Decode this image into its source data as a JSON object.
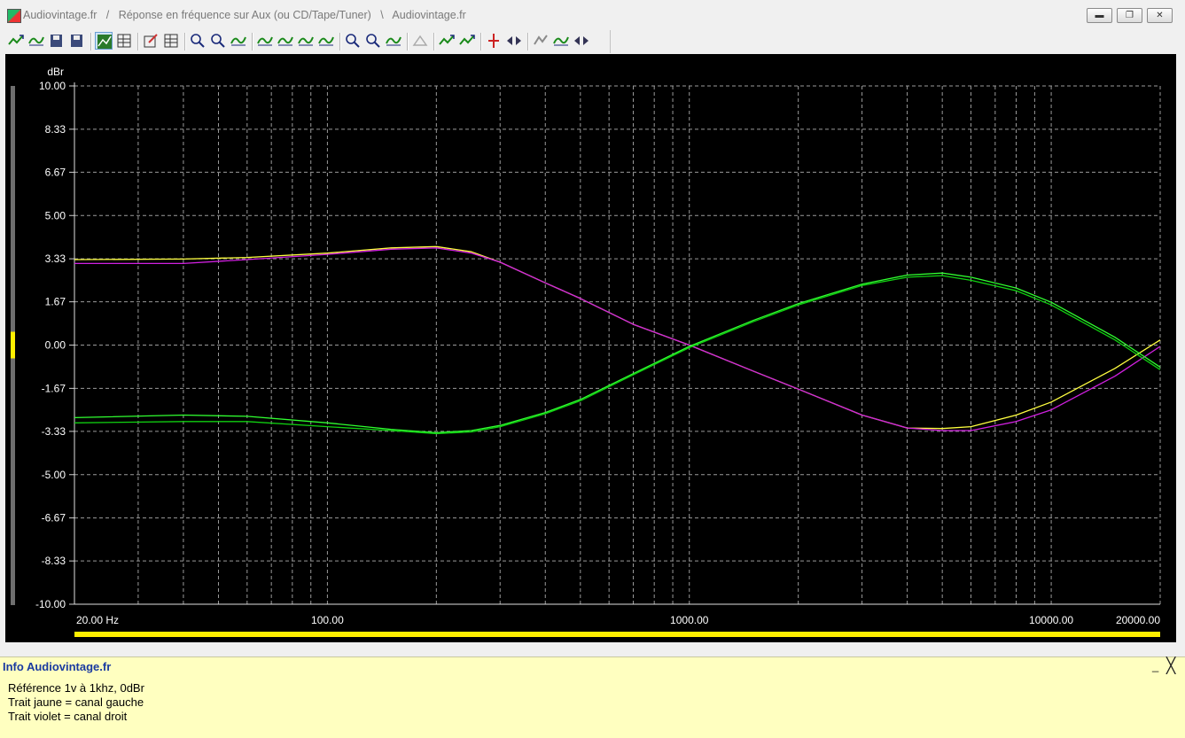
{
  "window": {
    "title": "Audiovintage.fr   /   Réponse en fréquence sur Aux (ou CD/Tape/Tuner)   \\   Audiovintage.fr",
    "minimize_label": "▬",
    "restore_label": "❐",
    "close_label": "✕"
  },
  "toolbar": {
    "groups": [
      [
        "add-curve-icon",
        "wave-icon",
        "save-icon",
        "copy-icon"
      ],
      [
        "graph-view-icon",
        "table-view-icon"
      ],
      [
        "edit-icon",
        "grid-points-icon"
      ],
      [
        "zoom-x-icon",
        "zoom-y-icon",
        "fit-curve-icon"
      ],
      [
        "curve-up-icon",
        "curve-down-icon",
        "curve-shift-icon",
        "curve-step-icon"
      ],
      [
        "zoom-in-icon",
        "zoom-out-icon",
        "reset-curve-icon"
      ],
      [
        "disabled-icon"
      ],
      [
        "marker-up-icon",
        "marker-down-icon"
      ],
      [
        "measure-icon",
        "arrows-icon"
      ],
      [
        "limit-icon",
        "compare-icon",
        "settings-icon"
      ]
    ]
  },
  "chart_data": {
    "type": "line",
    "ylabel": "dBr",
    "xscale": "log",
    "xlim": [
      20,
      20000
    ],
    "ylim": [
      -10,
      10
    ],
    "grid": true,
    "y_ticks": [
      "10.00",
      "8.33",
      "6.67",
      "5.00",
      "3.33",
      "1.67",
      "0.00",
      "-1.67",
      "-3.33",
      "-5.00",
      "-6.67",
      "-8.33",
      "-10.00"
    ],
    "x_ticks": [
      {
        "value": 20,
        "label": "20.00 Hz"
      },
      {
        "value": 100,
        "label": "100.00"
      },
      {
        "value": 1000,
        "label": "1000.00"
      },
      {
        "value": 10000,
        "label": "10000.00"
      },
      {
        "value": 20000,
        "label": "20000.00"
      }
    ],
    "series": [
      {
        "color": "#ffff40",
        "x": [
          20,
          40,
          60,
          100,
          150,
          200,
          250,
          300,
          400,
          500,
          700,
          1000,
          1500,
          2000,
          3000,
          4000,
          5000,
          6000,
          8000,
          10000,
          15000,
          20000
        ],
        "y": [
          3.3,
          3.32,
          3.38,
          3.55,
          3.75,
          3.8,
          3.6,
          3.2,
          2.4,
          1.8,
          0.8,
          0.0,
          -1.0,
          -1.7,
          -2.7,
          -3.2,
          -3.22,
          -3.15,
          -2.7,
          -2.2,
          -0.9,
          0.2
        ]
      },
      {
        "color": "#d020e0",
        "x": [
          20,
          40,
          60,
          100,
          150,
          200,
          250,
          300,
          400,
          500,
          700,
          1000,
          1500,
          2000,
          3000,
          4000,
          5000,
          6000,
          8000,
          10000,
          15000,
          20000
        ],
        "y": [
          3.15,
          3.15,
          3.3,
          3.5,
          3.7,
          3.75,
          3.55,
          3.2,
          2.4,
          1.8,
          0.8,
          0.0,
          -1.0,
          -1.7,
          -2.7,
          -3.2,
          -3.3,
          -3.3,
          -2.95,
          -2.5,
          -1.2,
          -0.05
        ]
      },
      {
        "color": "#30ff30",
        "x": [
          20,
          40,
          60,
          100,
          150,
          200,
          250,
          300,
          400,
          500,
          700,
          1000,
          1500,
          2000,
          3000,
          4000,
          5000,
          6000,
          8000,
          10000,
          15000,
          20000
        ],
        "y": [
          -2.8,
          -2.7,
          -2.75,
          -3.0,
          -3.25,
          -3.38,
          -3.3,
          -3.1,
          -2.6,
          -2.1,
          -1.1,
          -0.05,
          0.95,
          1.6,
          2.35,
          2.7,
          2.78,
          2.62,
          2.2,
          1.65,
          0.3,
          -0.85
        ]
      },
      {
        "color": "#10d010",
        "x": [
          20,
          40,
          60,
          100,
          150,
          200,
          250,
          300,
          400,
          500,
          700,
          1000,
          1500,
          2000,
          3000,
          4000,
          5000,
          6000,
          8000,
          10000,
          15000,
          20000
        ],
        "y": [
          -3.0,
          -2.95,
          -2.95,
          -3.15,
          -3.3,
          -3.42,
          -3.35,
          -3.15,
          -2.65,
          -2.15,
          -1.15,
          -0.1,
          0.9,
          1.55,
          2.3,
          2.62,
          2.68,
          2.5,
          2.1,
          1.55,
          0.2,
          -0.95
        ]
      }
    ]
  },
  "info": {
    "title": "Info Audiovintage.fr",
    "minimize_label": "_",
    "close_label": "╳",
    "lines": [
      "Référence 1v à 1khz, 0dBr",
      "Trait jaune = canal gauche",
      "Trait violet = canal droit"
    ]
  }
}
